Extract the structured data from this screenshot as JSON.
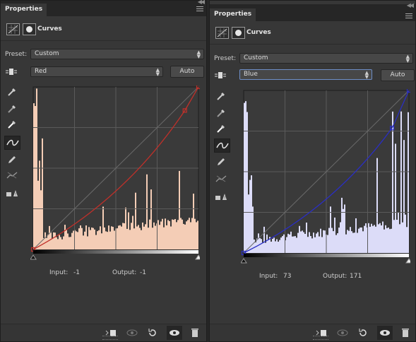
{
  "panels": [
    {
      "tab_label": "Properties",
      "title": "Curves",
      "preset_label": "Preset:",
      "preset_value": "Custom",
      "channel_value": "Red",
      "auto_label": "Auto",
      "input_label": "Input:",
      "input_value": "-1",
      "output_label": "Output:",
      "output_value": "-1",
      "curve_color": "#c0302a",
      "histogram_color": "#f4cdb6",
      "curve_points": [
        [
          0,
          0
        ],
        [
          234,
          218
        ],
        [
          255,
          255
        ]
      ]
    },
    {
      "tab_label": "Properties",
      "title": "Curves",
      "preset_label": "Preset:",
      "preset_value": "Custom",
      "channel_value": "Blue",
      "auto_label": "Auto",
      "input_label": "Input:",
      "input_value": "73",
      "output_label": "Output:",
      "output_value": "171",
      "curve_color": "#2a2ec4",
      "histogram_color": "#dcdcf8",
      "curve_points": [
        [
          0,
          0
        ],
        [
          229,
          196
        ],
        [
          255,
          255
        ]
      ]
    }
  ],
  "tools": [
    "on-image-adjust-icon",
    "sample-black-point-icon",
    "sample-gray-point-icon",
    "sample-white-point-icon",
    "curve-points-icon",
    "pencil-draw-icon",
    "smooth-curve-icon",
    "clipping-warning-icon"
  ],
  "footer": [
    "clip-to-layer-icon",
    "view-previous-state-icon",
    "reset-adjustment-icon",
    "toggle-visibility-icon",
    "delete-adjustment-icon"
  ]
}
